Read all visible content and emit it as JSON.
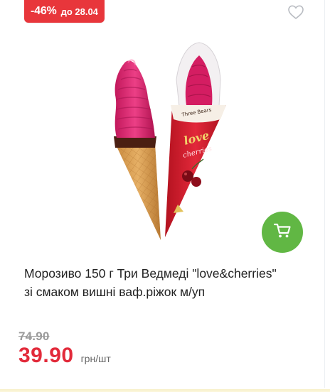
{
  "badge": {
    "discount": "-46%",
    "until": "до 28.04"
  },
  "product": {
    "title_line1": "Морозиво 150 г Три Ведмеді \"love&cherries\"",
    "title_line2": "зі смаком вишні ваф.ріжок м/уп",
    "image_icon": "ice-cream-cone-image",
    "packaging_text": {
      "brand": "Three Bears",
      "flavor_a": "love",
      "flavor_b": "cherries"
    }
  },
  "pricing": {
    "old_price": "74.90",
    "new_price": "39.90",
    "unit": "грн/шт"
  },
  "icons": {
    "favorite": "heart-icon",
    "cart": "cart-icon"
  },
  "colors": {
    "discount_badge": "#e8363b",
    "price": "#e22a3a",
    "cart_button": "#61b744"
  }
}
